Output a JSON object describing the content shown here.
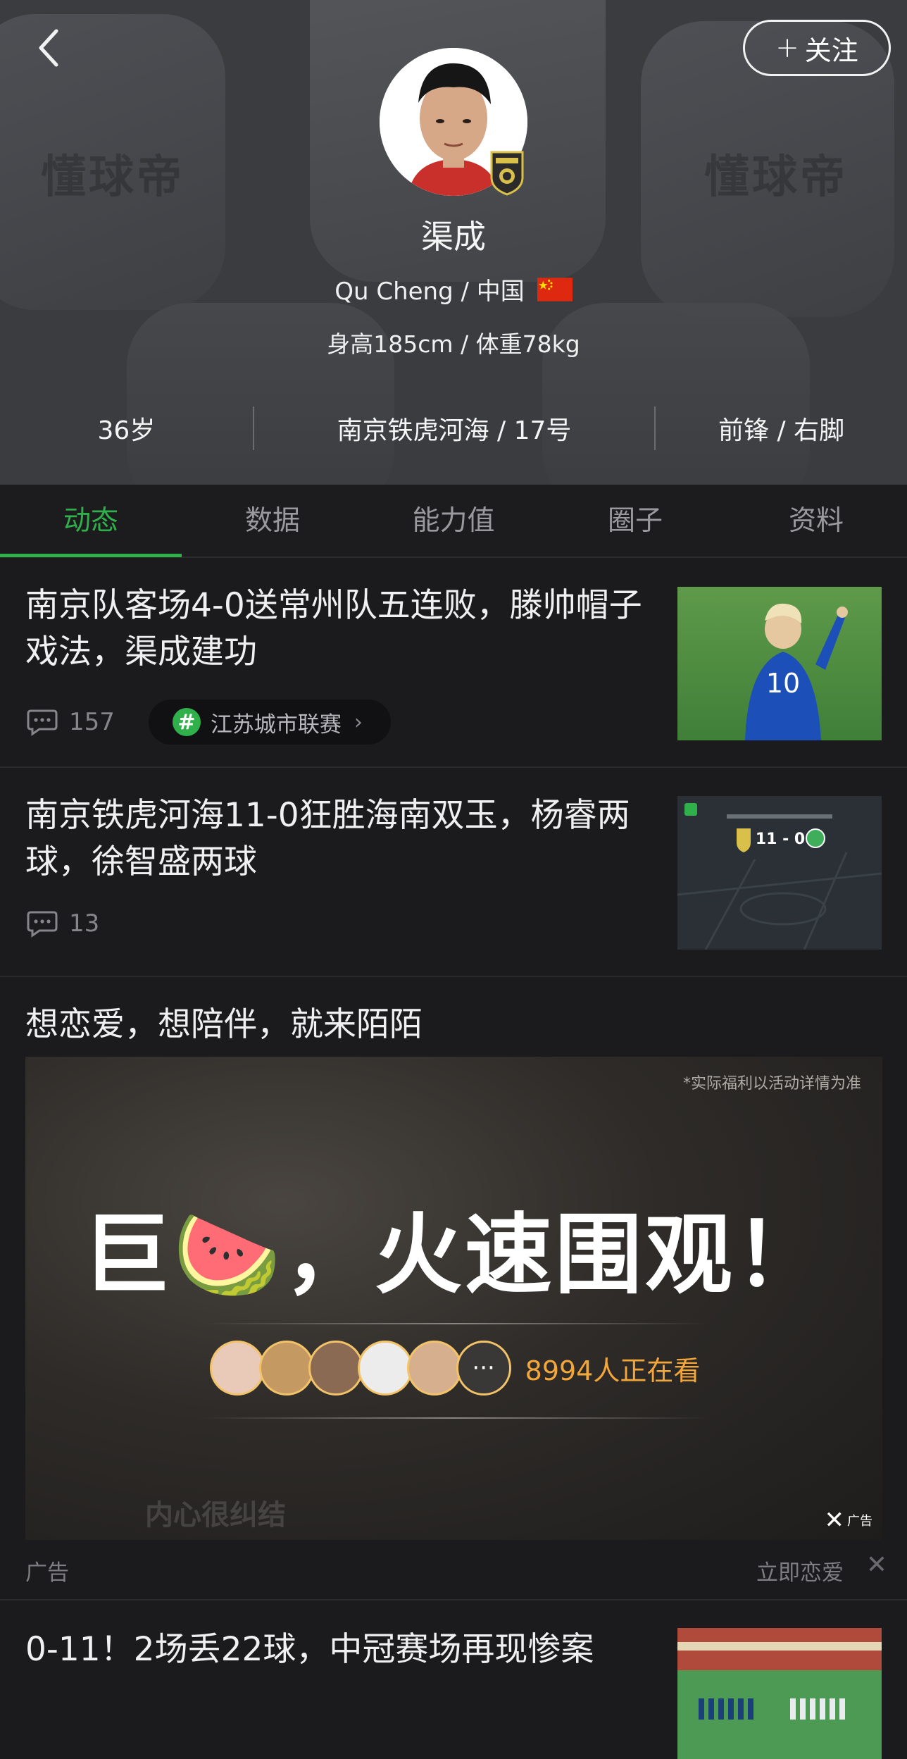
{
  "header": {
    "back_label": "",
    "follow_label": "关注",
    "watermark_left": "懂球帝",
    "watermark_right": "懂球帝",
    "player_name": "渠成",
    "name_country": "Qu Cheng / 中国",
    "height_weight": "身高185cm / 体重78kg",
    "stats": {
      "age": "36岁",
      "club_number": "南京铁虎河海 / 17号",
      "position_foot": "前锋 / 右脚"
    }
  },
  "tabs": [
    {
      "label": "动态",
      "active": true
    },
    {
      "label": "数据",
      "active": false
    },
    {
      "label": "能力值",
      "active": false
    },
    {
      "label": "圈子",
      "active": false
    },
    {
      "label": "资料",
      "active": false
    }
  ],
  "feed": [
    {
      "title": "南京队客场4-0送常州队五连败，滕帅帽子戏法，渠成建功",
      "comments": "157",
      "tag": "江苏城市联赛",
      "thumb_jersey": "10"
    },
    {
      "title": "南京铁虎河海11-0狂胜海南双玉，杨睿两球，徐智盛两球",
      "comments": "13",
      "thumb_score": "11 - 0"
    },
    {
      "title": "0-11！2场丢22球，中冠赛场再现惨案"
    }
  ],
  "ad": {
    "title": "想恋爱，想陪伴，就来陌陌",
    "note": "*实际福利以活动详情为准",
    "headline": "巨🍉，火速围观！",
    "viewers": "8994人正在看",
    "watermark": "内心很纠结",
    "logo_text": "广告",
    "footer_label": "广告",
    "cta": "立即恋爱",
    "close": "✕"
  },
  "colors": {
    "accent": "#2fb04a",
    "background": "#1b1b1d",
    "header_bg": "#3a3c40",
    "viewer_orange": "#f3a63a"
  }
}
